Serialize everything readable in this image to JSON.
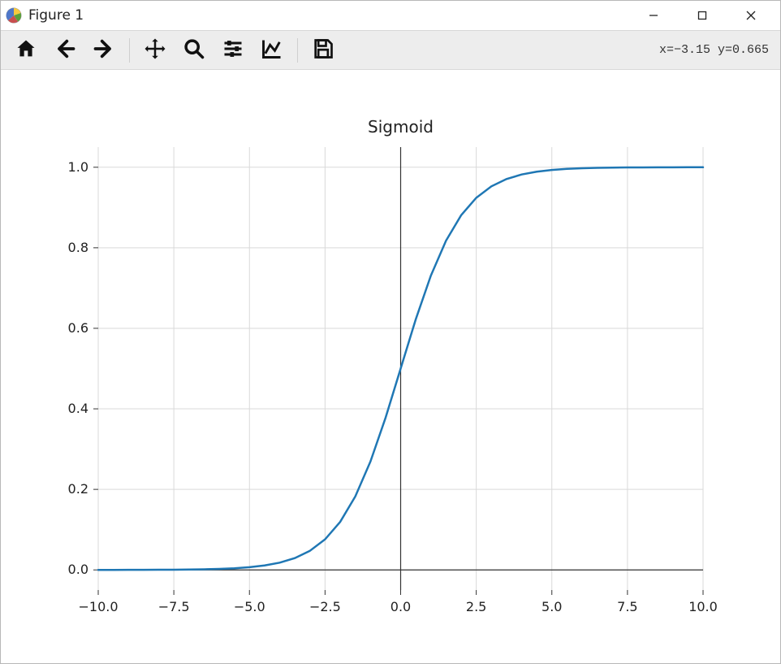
{
  "window": {
    "title": "Figure 1"
  },
  "toolbar": {
    "coord_readout": "x=−3.15 y=0.665"
  },
  "chart_data": {
    "type": "line",
    "title": "Sigmoid",
    "x": [
      -10.0,
      -9.5,
      -9.0,
      -8.5,
      -8.0,
      -7.5,
      -7.0,
      -6.5,
      -6.0,
      -5.5,
      -5.0,
      -4.5,
      -4.0,
      -3.5,
      -3.0,
      -2.5,
      -2.0,
      -1.5,
      -1.0,
      -0.5,
      0.0,
      0.5,
      1.0,
      1.5,
      2.0,
      2.5,
      3.0,
      3.5,
      4.0,
      4.5,
      5.0,
      5.5,
      6.0,
      6.5,
      7.0,
      7.5,
      8.0,
      8.5,
      9.0,
      9.5,
      10.0
    ],
    "y": [
      4.54e-05,
      7.49e-05,
      0.000123,
      0.000203,
      0.000335,
      0.000553,
      0.000911,
      0.0015,
      0.00247,
      0.00407,
      0.00669,
      0.01099,
      0.01799,
      0.02931,
      0.04743,
      0.07586,
      0.1192,
      0.18243,
      0.26894,
      0.37754,
      0.5,
      0.62246,
      0.73106,
      0.81757,
      0.8808,
      0.92414,
      0.95257,
      0.97069,
      0.98201,
      0.98901,
      0.99331,
      0.99593,
      0.99753,
      0.9985,
      0.99909,
      0.99945,
      0.99966,
      0.9998,
      0.99988,
      0.99993,
      0.99995
    ],
    "x_ticks": [
      -10.0,
      -7.5,
      -5.0,
      -2.5,
      0.0,
      2.5,
      5.0,
      7.5,
      10.0
    ],
    "x_tick_labels": [
      "−10.0",
      "−7.5",
      "−5.0",
      "−2.5",
      "0.0",
      "2.5",
      "5.0",
      "7.5",
      "10.0"
    ],
    "y_ticks": [
      0.0,
      0.2,
      0.4,
      0.6,
      0.8,
      1.0
    ],
    "y_tick_labels": [
      "0.0",
      "0.2",
      "0.4",
      "0.6",
      "0.8",
      "1.0"
    ],
    "xlim": [
      -10.0,
      10.0
    ],
    "ylim": [
      -0.05,
      1.05
    ],
    "line_color": "#1f77b4",
    "grid_color": "#d9d9d9",
    "axis_color": "#333333"
  }
}
